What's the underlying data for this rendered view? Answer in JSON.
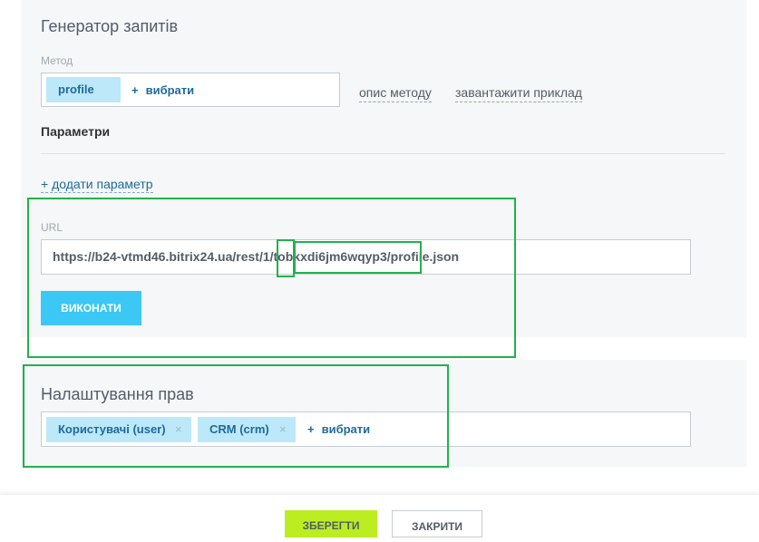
{
  "generator": {
    "title": "Генератор запитів",
    "method_label": "Метод",
    "method_tag": "profile",
    "select_label": "вибрати",
    "method_description_link": "опис методу",
    "load_example_link": "завантажити приклад",
    "params_title": "Параметри",
    "add_param_link": "+ додати параметр",
    "url_label": "URL",
    "url_value": "https://b24-vtmd46.bitrix24.ua/rest/1/tobkxdi6jm6wqyp3/profile.json",
    "run_button": "ВИКОНАТИ"
  },
  "rights": {
    "title": "Налаштування прав",
    "tags": [
      "Користувачі (user)",
      "CRM (crm)"
    ],
    "select_label": "вибрати"
  },
  "footer": {
    "save_button": "ЗБЕРЕГТИ",
    "close_button": "ЗАКРИТИ"
  },
  "colors": {
    "tag_bg": "#bce8f9",
    "accent": "#3bc8f5",
    "save": "#bbed21",
    "highlight": "#22b14c"
  }
}
